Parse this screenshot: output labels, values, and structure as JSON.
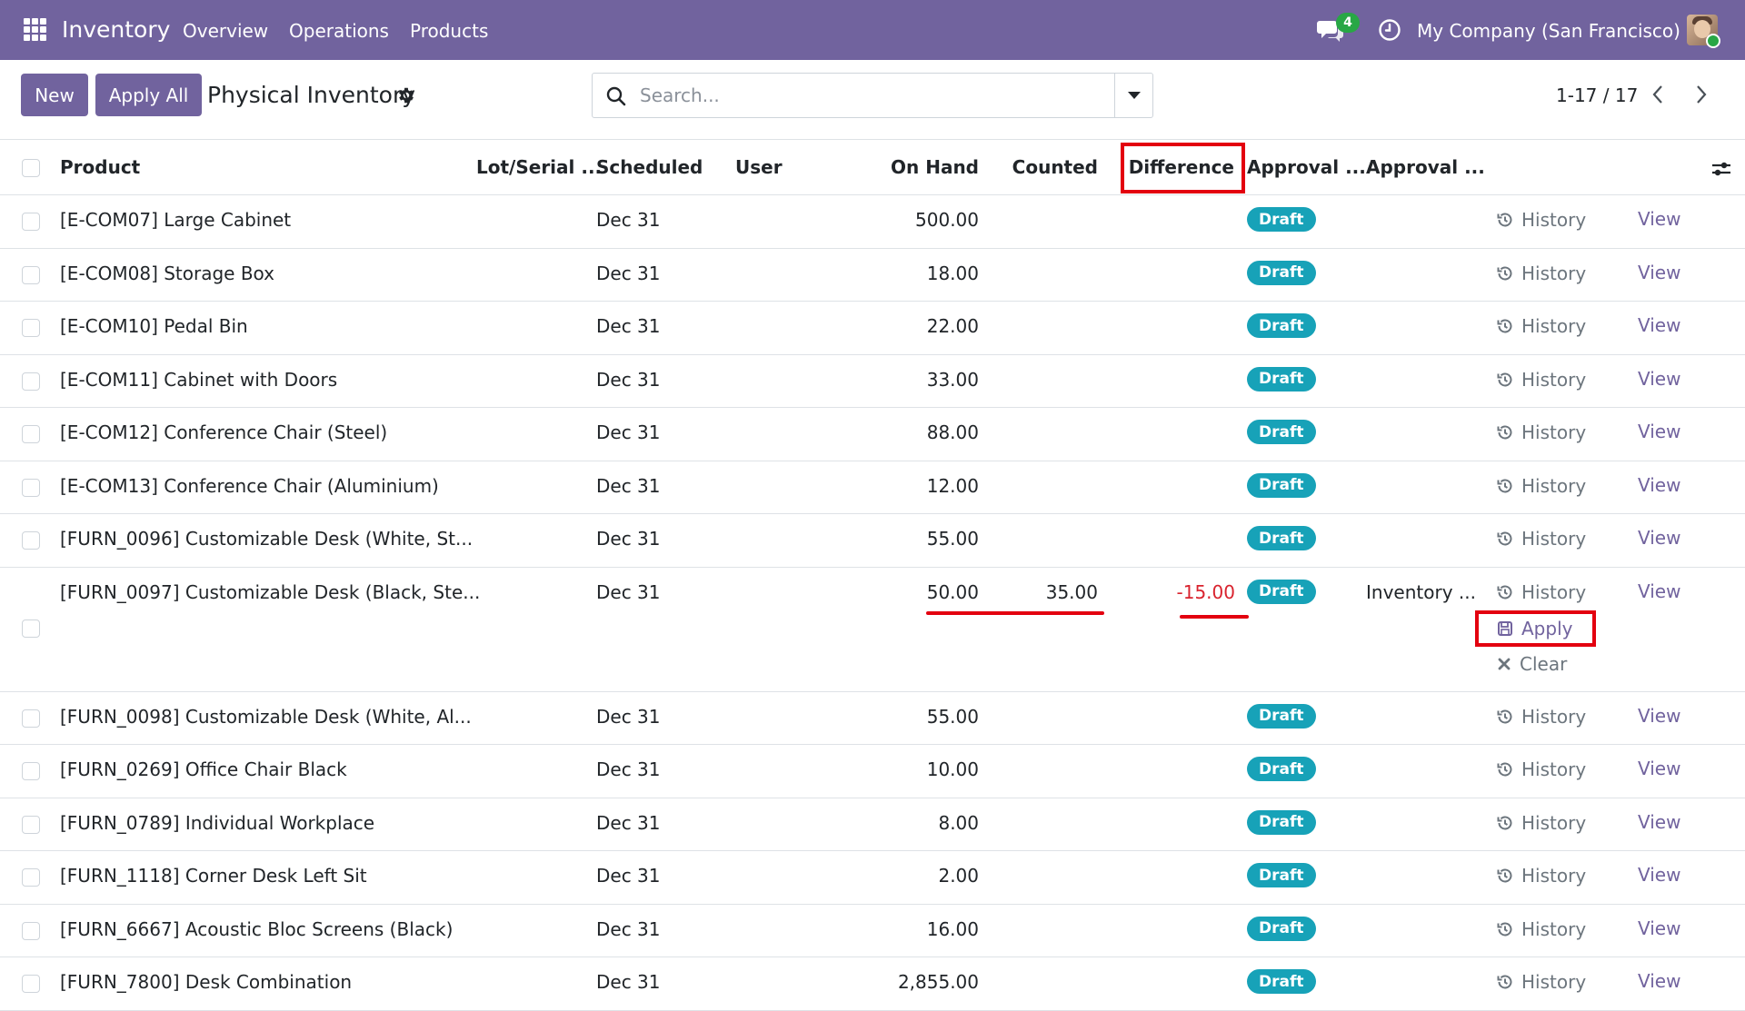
{
  "navbar": {
    "app_name": "Inventory",
    "menu": [
      "Overview",
      "Operations",
      "Products"
    ],
    "chat_badge": "4",
    "company": "My Company (San Francisco)"
  },
  "control": {
    "new_label": "New",
    "apply_all_label": "Apply All",
    "title": "Physical Inventory",
    "search_placeholder": "Search...",
    "pager": "1-17 / 17"
  },
  "columns": {
    "product": "Product",
    "lot": "Lot/Serial ...",
    "scheduled": "Scheduled",
    "user": "User",
    "on_hand": "On Hand",
    "counted": "Counted",
    "difference": "Difference",
    "approval1": "Approval ...",
    "approval2": "Approval ..."
  },
  "rows": [
    {
      "product": "[E-COM07] Large Cabinet",
      "scheduled": "Dec 31",
      "on_hand": "500.00",
      "counted": "",
      "difference": "",
      "status": "Draft",
      "approval": "",
      "history": "History",
      "view": "View"
    },
    {
      "product": "[E-COM08] Storage Box",
      "scheduled": "Dec 31",
      "on_hand": "18.00",
      "counted": "",
      "difference": "",
      "status": "Draft",
      "approval": "",
      "history": "History",
      "view": "View"
    },
    {
      "product": "[E-COM10] Pedal Bin",
      "scheduled": "Dec 31",
      "on_hand": "22.00",
      "counted": "",
      "difference": "",
      "status": "Draft",
      "approval": "",
      "history": "History",
      "view": "View"
    },
    {
      "product": "[E-COM11] Cabinet with Doors",
      "scheduled": "Dec 31",
      "on_hand": "33.00",
      "counted": "",
      "difference": "",
      "status": "Draft",
      "approval": "",
      "history": "History",
      "view": "View"
    },
    {
      "product": "[E-COM12] Conference Chair (Steel)",
      "scheduled": "Dec 31",
      "on_hand": "88.00",
      "counted": "",
      "difference": "",
      "status": "Draft",
      "approval": "",
      "history": "History",
      "view": "View"
    },
    {
      "product": "[E-COM13] Conference Chair (Aluminium)",
      "scheduled": "Dec 31",
      "on_hand": "12.00",
      "counted": "",
      "difference": "",
      "status": "Draft",
      "approval": "",
      "history": "History",
      "view": "View"
    },
    {
      "product": "[FURN_0096] Customizable Desk (White, St...",
      "scheduled": "Dec 31",
      "on_hand": "55.00",
      "counted": "",
      "difference": "",
      "status": "Draft",
      "approval": "",
      "history": "History",
      "view": "View"
    },
    {
      "product": "[FURN_0097] Customizable Desk (Black, Ste...",
      "scheduled": "Dec 31",
      "on_hand": "50.00",
      "counted": "35.00",
      "difference": "-15.00",
      "status": "Draft",
      "approval": "Inventory ...",
      "history": "History",
      "view": "View",
      "apply": "Apply",
      "clear": "Clear"
    },
    {
      "product": "[FURN_0098] Customizable Desk (White, Al...",
      "scheduled": "Dec 31",
      "on_hand": "55.00",
      "counted": "",
      "difference": "",
      "status": "Draft",
      "approval": "",
      "history": "History",
      "view": "View"
    },
    {
      "product": "[FURN_0269] Office Chair Black",
      "scheduled": "Dec 31",
      "on_hand": "10.00",
      "counted": "",
      "difference": "",
      "status": "Draft",
      "approval": "",
      "history": "History",
      "view": "View"
    },
    {
      "product": "[FURN_0789] Individual Workplace",
      "scheduled": "Dec 31",
      "on_hand": "8.00",
      "counted": "",
      "difference": "",
      "status": "Draft",
      "approval": "",
      "history": "History",
      "view": "View"
    },
    {
      "product": "[FURN_1118] Corner Desk Left Sit",
      "scheduled": "Dec 31",
      "on_hand": "2.00",
      "counted": "",
      "difference": "",
      "status": "Draft",
      "approval": "",
      "history": "History",
      "view": "View"
    },
    {
      "product": "[FURN_6667] Acoustic Bloc Screens (Black)",
      "scheduled": "Dec 31",
      "on_hand": "16.00",
      "counted": "",
      "difference": "",
      "status": "Draft",
      "approval": "",
      "history": "History",
      "view": "View"
    },
    {
      "product": "[FURN_7800] Desk Combination",
      "scheduled": "Dec 31",
      "on_hand": "2,855.00",
      "counted": "",
      "difference": "",
      "status": "Draft",
      "approval": "",
      "history": "History",
      "view": "View"
    }
  ],
  "colors": {
    "brand": "#71639e",
    "badge": "#17a2b8",
    "negative": "#d9232e",
    "annotation": "#e3000f"
  }
}
